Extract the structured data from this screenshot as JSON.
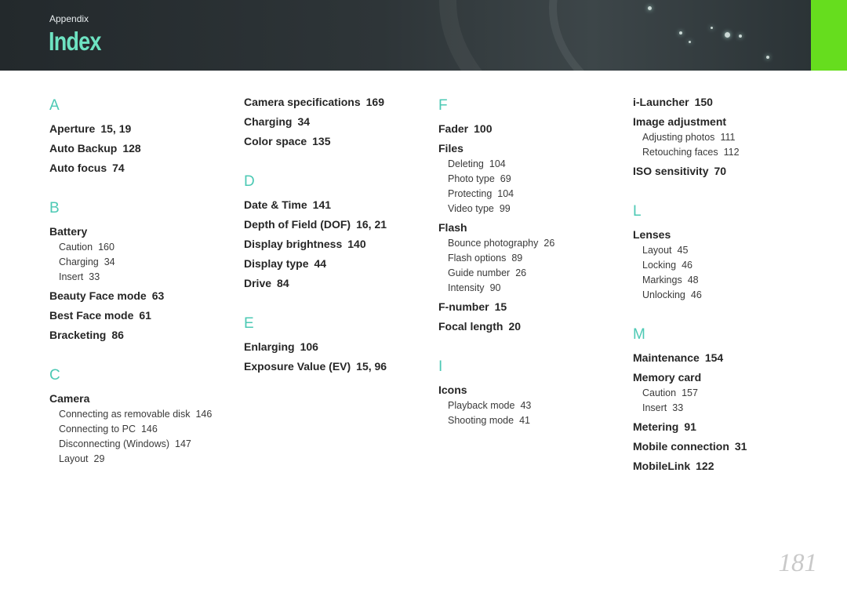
{
  "header": {
    "section": "Appendix",
    "title": "Index",
    "accent_color": "#66dd1e",
    "title_color": "#6ee3c2"
  },
  "col1": [
    {
      "letter": "A",
      "entries": [
        {
          "label": "Aperture",
          "pages": "15, 19"
        },
        {
          "label": "Auto Backup",
          "pages": "128"
        },
        {
          "label": "Auto focus",
          "pages": "74"
        }
      ]
    },
    {
      "letter": "B",
      "entries": [
        {
          "label": "Battery",
          "pages": "",
          "subs": [
            {
              "label": "Caution",
              "pages": "160"
            },
            {
              "label": "Charging",
              "pages": "34"
            },
            {
              "label": "Insert",
              "pages": "33"
            }
          ]
        },
        {
          "label": "Beauty Face mode",
          "pages": "63"
        },
        {
          "label": "Best Face mode",
          "pages": "61"
        },
        {
          "label": "Bracketing",
          "pages": "86"
        }
      ]
    },
    {
      "letter": "C",
      "entries": [
        {
          "label": "Camera",
          "pages": "",
          "subs": [
            {
              "label": "Connecting as removable disk",
              "pages": "146"
            },
            {
              "label": "Connecting to PC",
              "pages": "146"
            },
            {
              "label": "Disconnecting (Windows)",
              "pages": "147"
            },
            {
              "label": "Layout",
              "pages": "29"
            }
          ]
        }
      ]
    }
  ],
  "col2": [
    {
      "letter": "",
      "entries": [
        {
          "label": "Camera specifications",
          "pages": "169"
        },
        {
          "label": "Charging",
          "pages": "34"
        },
        {
          "label": "Color space",
          "pages": "135"
        }
      ]
    },
    {
      "letter": "D",
      "entries": [
        {
          "label": "Date & Time",
          "pages": "141"
        },
        {
          "label": "Depth of Field (DOF)",
          "pages": "16, 21"
        },
        {
          "label": "Display brightness",
          "pages": "140"
        },
        {
          "label": "Display type",
          "pages": "44"
        },
        {
          "label": "Drive",
          "pages": "84"
        }
      ]
    },
    {
      "letter": "E",
      "entries": [
        {
          "label": "Enlarging",
          "pages": "106"
        },
        {
          "label": "Exposure Value (EV)",
          "pages": "15, 96"
        }
      ]
    }
  ],
  "col3": [
    {
      "letter": "F",
      "entries": [
        {
          "label": "Fader",
          "pages": "100"
        },
        {
          "label": "Files",
          "pages": "",
          "subs": [
            {
              "label": "Deleting",
              "pages": "104"
            },
            {
              "label": "Photo type",
              "pages": "69"
            },
            {
              "label": "Protecting",
              "pages": "104"
            },
            {
              "label": "Video type",
              "pages": "99"
            }
          ]
        },
        {
          "label": "Flash",
          "pages": "",
          "subs": [
            {
              "label": "Bounce photography",
              "pages": "26"
            },
            {
              "label": "Flash options",
              "pages": "89"
            },
            {
              "label": "Guide number",
              "pages": "26"
            },
            {
              "label": "Intensity",
              "pages": "90"
            }
          ]
        },
        {
          "label": "F-number",
          "pages": "15"
        },
        {
          "label": "Focal length",
          "pages": "20"
        }
      ]
    },
    {
      "letter": "I",
      "entries": [
        {
          "label": "Icons",
          "pages": "",
          "subs": [
            {
              "label": "Playback mode",
              "pages": "43"
            },
            {
              "label": "Shooting mode",
              "pages": "41"
            }
          ]
        }
      ]
    }
  ],
  "col4": [
    {
      "letter": "",
      "entries": [
        {
          "label": "i-Launcher",
          "pages": "150"
        },
        {
          "label": "Image adjustment",
          "pages": "",
          "subs": [
            {
              "label": "Adjusting photos",
              "pages": "111"
            },
            {
              "label": "Retouching faces",
              "pages": "112"
            }
          ]
        },
        {
          "label": "ISO sensitivity",
          "pages": "70"
        }
      ]
    },
    {
      "letter": "L",
      "entries": [
        {
          "label": "Lenses",
          "pages": "",
          "subs": [
            {
              "label": "Layout",
              "pages": "45"
            },
            {
              "label": "Locking",
              "pages": "46"
            },
            {
              "label": "Markings",
              "pages": "48"
            },
            {
              "label": "Unlocking",
              "pages": "46"
            }
          ]
        }
      ]
    },
    {
      "letter": "M",
      "entries": [
        {
          "label": "Maintenance",
          "pages": "154"
        },
        {
          "label": "Memory card",
          "pages": "",
          "subs": [
            {
              "label": "Caution",
              "pages": "157"
            },
            {
              "label": "Insert",
              "pages": "33"
            }
          ]
        },
        {
          "label": "Metering",
          "pages": "91"
        },
        {
          "label": "Mobile connection",
          "pages": "31"
        },
        {
          "label": "MobileLink",
          "pages": "122"
        }
      ]
    }
  ],
  "page_number": "181"
}
